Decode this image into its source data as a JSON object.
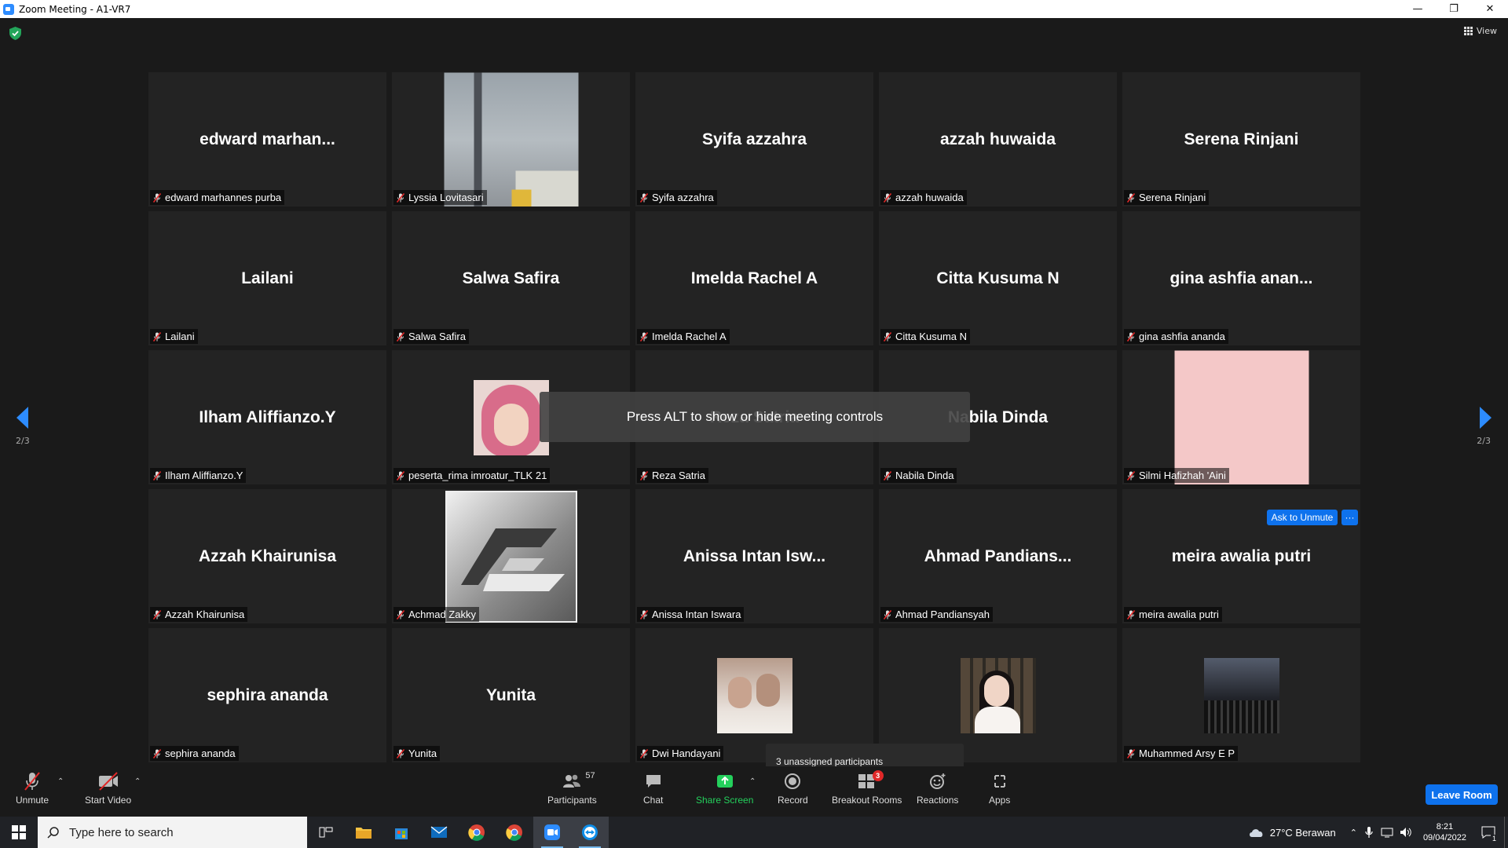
{
  "window": {
    "title": "Zoom Meeting - A1-VR7"
  },
  "view": {
    "label": "View"
  },
  "pagination": {
    "left": "2/3",
    "right": "2/3"
  },
  "tiles": [
    {
      "name": "edward  marhan...",
      "label": "edward marhannes purba"
    },
    {
      "name": "",
      "label": "Lyssia Lovitasari",
      "photo": "sky"
    },
    {
      "name": "Syifa azzahra",
      "label": "Syifa azzahra"
    },
    {
      "name": "azzah huwaida",
      "label": "azzah huwaida"
    },
    {
      "name": "Serena Rinjani",
      "label": "Serena Rinjani"
    },
    {
      "name": "Lailani",
      "label": "Lailani"
    },
    {
      "name": "Salwa Safira",
      "label": "Salwa Safira"
    },
    {
      "name": "Imelda Rachel A",
      "label": "Imelda Rachel A"
    },
    {
      "name": "Citta Kusuma N",
      "label": "Citta Kusuma N"
    },
    {
      "name": "gina  ashfia  anan...",
      "label": "gina ashfia ananda"
    },
    {
      "name": "Ilham Aliffianzo.Y",
      "label": "Ilham Aliffianzo.Y"
    },
    {
      "name": "",
      "label": "peserta_rima imroatur_TLK 21",
      "photo": "hijab"
    },
    {
      "name": "Reza Satria",
      "label": "Reza Satria"
    },
    {
      "name": "Nabila Dinda",
      "label": "Nabila Dinda"
    },
    {
      "name": "",
      "label": "Silmi Hafizhah 'Aini",
      "photo": "pink"
    },
    {
      "name": "Azzah Khairunisa",
      "label": "Azzah Khairunisa"
    },
    {
      "name": "",
      "label": "Achmad Zakky",
      "photo": "az"
    },
    {
      "name": "Anissa  Intan  Isw...",
      "label": "Anissa Intan Iswara"
    },
    {
      "name": "Ahmad  Pandians...",
      "label": "Ahmad Pandiansyah"
    },
    {
      "name": "meira awalia putri",
      "label": "meira awalia putri"
    },
    {
      "name": "sephira ananda",
      "label": "sephira ananda"
    },
    {
      "name": "Yunita",
      "label": "Yunita"
    },
    {
      "name": "",
      "label": "Dwi Handayani",
      "photo": "cat"
    },
    {
      "name": "",
      "label": "",
      "photo": "lady"
    },
    {
      "name": "",
      "label": "Muhammed Arsy E P",
      "photo": "group"
    }
  ],
  "overlay": {
    "message": "Press ALT to show or hide meeting controls"
  },
  "hover_actions": {
    "ask_unmute": "Ask to Unmute",
    "more": "···"
  },
  "tooltip": {
    "text": "3 unassigned participants"
  },
  "toolbar": {
    "unmute": "Unmute",
    "start_video": "Start Video",
    "participants": "Participants",
    "participants_count": "57",
    "chat": "Chat",
    "share_screen": "Share Screen",
    "record": "Record",
    "breakout_rooms": "Breakout Rooms",
    "breakout_badge": "3",
    "reactions": "Reactions",
    "apps": "Apps",
    "leave": "Leave Room"
  },
  "colors": {
    "accent": "#0e72ed",
    "share_green": "#24d05c",
    "mute_red": "#e02828"
  },
  "taskbar": {
    "search_placeholder": "Type here to search",
    "weather": "27°C  Berawan",
    "time": "8:21",
    "date": "09/04/2022",
    "notification_count": "1"
  }
}
